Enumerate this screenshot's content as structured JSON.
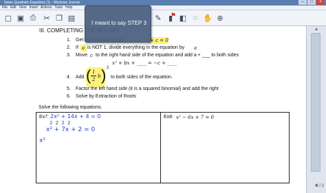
{
  "window": {
    "title": "Notes Quadratic Equations (1) - Windows Journal"
  },
  "menu": [
    "File",
    "Edit",
    "View",
    "Insert",
    "Actions",
    "Tools",
    "Help"
  ],
  "toolbar_icons": [
    "new-page-icon",
    "save-icon",
    "print-icon",
    "cut-icon",
    "copy-icon",
    "paste-icon",
    "pen-icon",
    "highlighter-icon",
    "eraser-icon",
    "lasso-icon",
    "hand-icon",
    "zoom-icon",
    "flag-icon"
  ],
  "tooltip": {
    "text": "I meant to say STEP 3"
  },
  "notes": {
    "heading": "III.  COMPLETING THE SQUARE",
    "step1_num": "1.",
    "step1": "Get into Standard form",
    "step1_eq": "+ c = 0",
    "step2_num": "2.",
    "step2_a": "If",
    "step2_var": "a",
    "step2_b": "is NOT 1, divide everything in the equation by",
    "step2_var2": "a",
    "step3_num": "3.",
    "step3": "Move",
    "step3_var": "c",
    "step3_b": "to the right hand side of the equation and add a + ___ to both sides",
    "step3_eq": "x² + bx + ____ = −c + ____",
    "step4_num": "4.",
    "step4_a": "Add",
    "step4_num_frac": "1",
    "step4_den_frac": "2",
    "step4_var": "b",
    "step4_exp": "2",
    "step4_b": "to both sides of the equation.",
    "step5_num": "5.",
    "step5": "Factor the left hand side (it is a squared binomial) and add the right",
    "step6_num": "6.",
    "step6": "Solve by Extraction of Roots",
    "solve_heading": "Solve the following equations.",
    "ex7_label": "Ex7:",
    "ex7_eq": "2x² + 14x + 4 = 0",
    "ex7_ink_div": "2    2    2    2",
    "ex7_ink_line2": "x² + 7x + 2 = 0",
    "ex7_ink_line3": "x²",
    "ex8_label": "Ex8:",
    "ex8_eq": "x² − 6x + 7 = 0"
  },
  "status": {
    "page": "2 / 2"
  }
}
